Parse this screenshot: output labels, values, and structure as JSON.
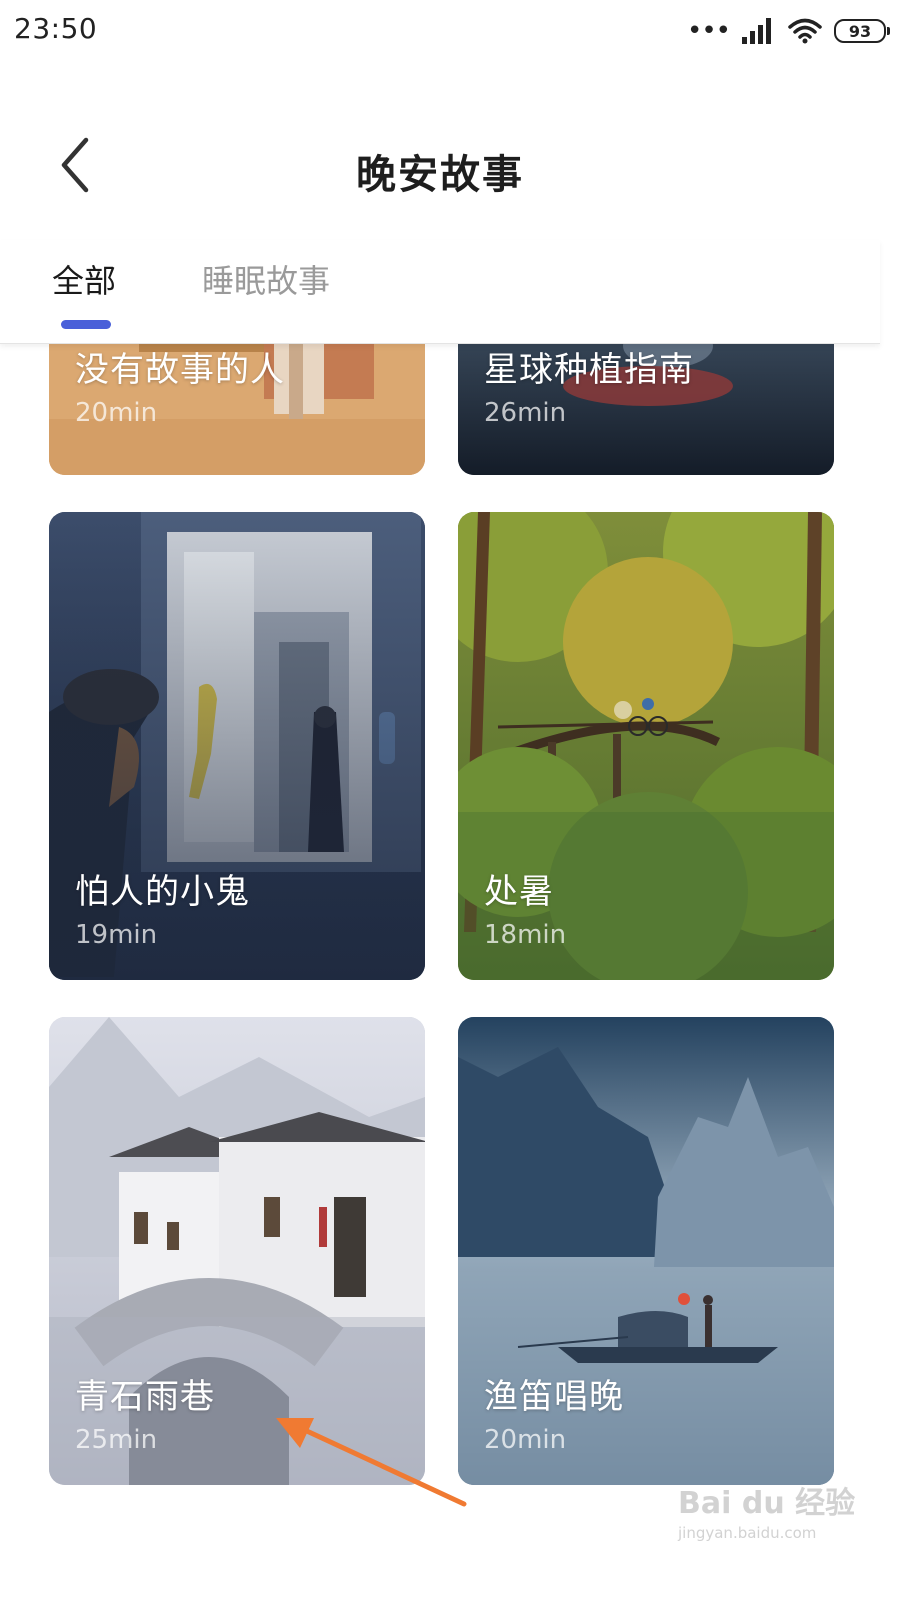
{
  "status_bar": {
    "time": "23:50",
    "battery": "93"
  },
  "header": {
    "title": "晚安故事"
  },
  "tabs": [
    {
      "label": "全部",
      "active": true
    },
    {
      "label": "睡眠故事",
      "active": false
    }
  ],
  "stories": [
    {
      "title": "没有故事的人",
      "duration": "20min"
    },
    {
      "title": "星球种植指南",
      "duration": "26min"
    },
    {
      "title": "怕人的小鬼",
      "duration": "19min"
    },
    {
      "title": "处暑",
      "duration": "18min"
    },
    {
      "title": "青石雨巷",
      "duration": "25min"
    },
    {
      "title": "渔笛唱晚",
      "duration": "20min"
    }
  ],
  "watermark": {
    "text": "Bai du 经验",
    "url_text": "jingyan.baidu.com"
  },
  "colors": {
    "accent": "#4a60d9",
    "arrow": "#f07a32"
  },
  "icons": [
    "back-icon",
    "signal-icon",
    "wifi-icon",
    "battery-icon"
  ]
}
